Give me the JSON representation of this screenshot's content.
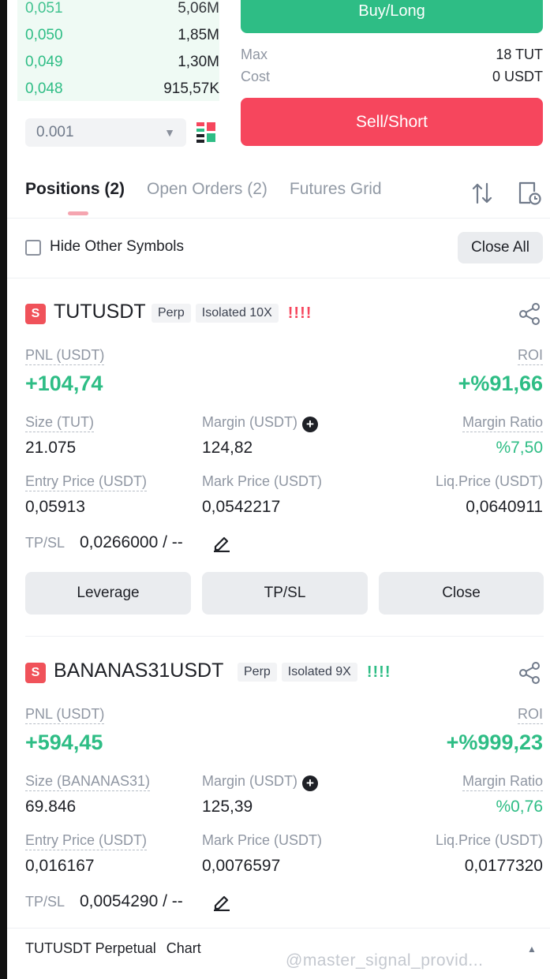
{
  "orderbook": {
    "rows": [
      {
        "price": "0,051",
        "qty": "5,06M"
      },
      {
        "price": "0,050",
        "qty": "1,85M"
      },
      {
        "price": "0,049",
        "qty": "1,30M"
      },
      {
        "price": "0,048",
        "qty": "915,57K"
      }
    ],
    "precision": "0.001"
  },
  "trade": {
    "buy_label": "Buy/Long",
    "max_label": "Max",
    "max_value": "18 TUT",
    "cost_label": "Cost",
    "cost_value": "0 USDT",
    "sell_label": "Sell/Short"
  },
  "tabs": [
    {
      "label": "Positions (2)"
    },
    {
      "label": "Open Orders (2)"
    },
    {
      "label": "Futures Grid"
    }
  ],
  "filter": {
    "hide_label": "Hide Other Symbols",
    "close_all": "Close All"
  },
  "positions": [
    {
      "side_badge": "S",
      "symbol": "TUTUSDT",
      "type": "Perp",
      "margin_mode": "Isolated 10X",
      "risk_bars": "!!!!",
      "pnl_label": "PNL (USDT)",
      "pnl": "+104,74",
      "roi_label": "ROI",
      "roi": "+%91,66",
      "size_label": "Size (TUT)",
      "size": "21.075",
      "margin_label": "Margin (USDT)",
      "margin": "124,82",
      "margin_ratio_label": "Margin Ratio",
      "margin_ratio": "%7,50",
      "entry_label": "Entry Price (USDT)",
      "entry": "0,05913",
      "mark_label": "Mark Price (USDT)",
      "mark": "0,0542217",
      "liq_label": "Liq.Price (USDT)",
      "liq": "0,0640911",
      "tpsl_label": "TP/SL",
      "tpsl": "0,0266000 / --",
      "buttons": [
        "Leverage",
        "TP/SL",
        "Close"
      ]
    },
    {
      "side_badge": "S",
      "symbol": "BANANAS31USDT",
      "type": "Perp",
      "margin_mode": "Isolated 9X",
      "risk_bars": "!!!!",
      "pnl_label": "PNL (USDT)",
      "pnl": "+594,45",
      "roi_label": "ROI",
      "roi": "+%999,23",
      "size_label": "Size (BANANAS31)",
      "size": "69.846",
      "margin_label": "Margin (USDT)",
      "margin": "125,39",
      "margin_ratio_label": "Margin Ratio",
      "margin_ratio": "%0,76",
      "entry_label": "Entry Price (USDT)",
      "entry": "0,016167",
      "mark_label": "Mark Price (USDT)",
      "mark": "0,0076597",
      "liq_label": "Liq.Price (USDT)",
      "liq": "0,0177320",
      "tpsl_label": "TP/SL",
      "tpsl": "0,0054290 / --"
    }
  ],
  "footer": {
    "symbol": "TUTUSDT Perpetual",
    "chart": "Chart",
    "watermark": "@master_signal_provid..."
  },
  "colors": {
    "green": "#2ebd85",
    "red": "#f6465d",
    "text": "#1e2026",
    "muted": "#8f96a2"
  }
}
